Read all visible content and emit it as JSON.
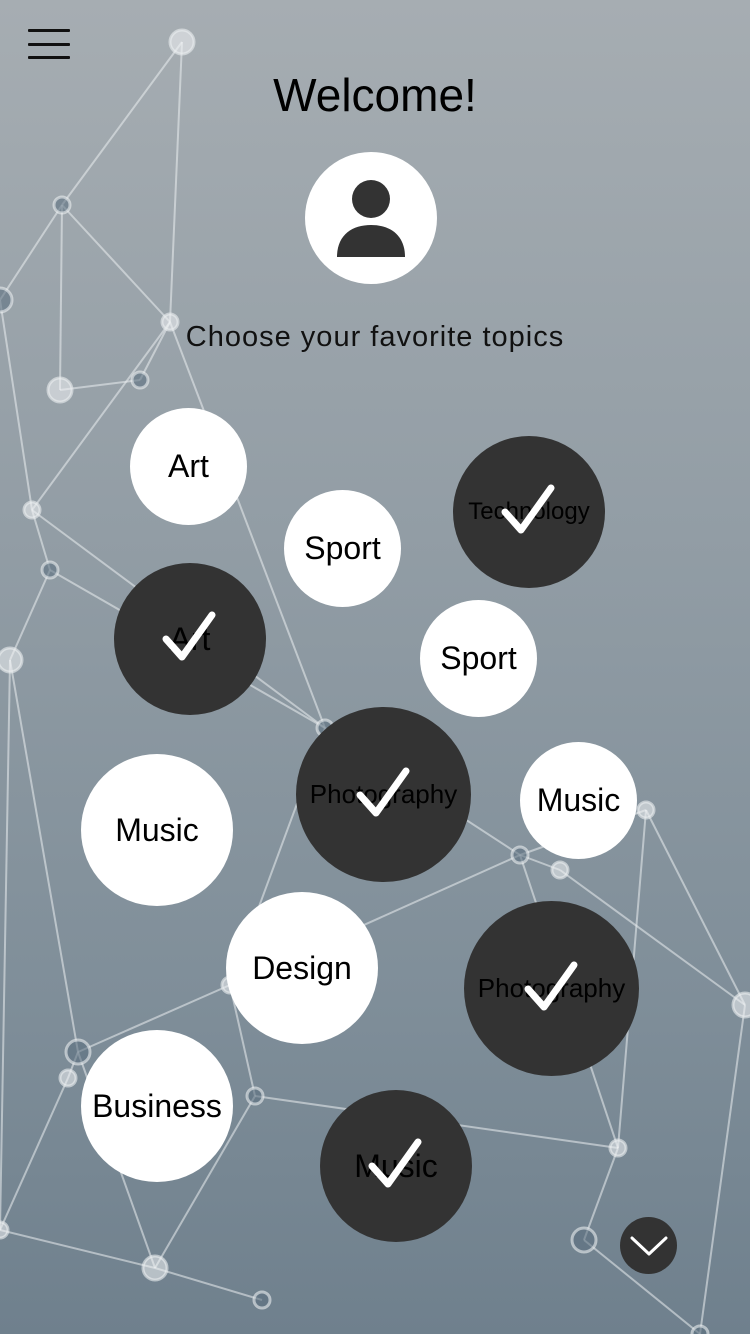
{
  "header": {
    "title": "Welcome!",
    "subtitle": "Choose your favorite topics"
  },
  "icons": {
    "menu": "hamburger-menu-icon",
    "avatar": "user-avatar-icon",
    "check": "checkmark-icon",
    "scroll": "chevron-down-icon"
  },
  "colors": {
    "selected_bubble": "#333333",
    "unselected_bubble": "#ffffff",
    "check": "#ffffff"
  },
  "topics": [
    {
      "label": "Art",
      "selected": false
    },
    {
      "label": "Sport",
      "selected": false
    },
    {
      "label": "Technology",
      "selected": true
    },
    {
      "label": "Art",
      "selected": true
    },
    {
      "label": "Sport",
      "selected": false
    },
    {
      "label": "Photography",
      "selected": true
    },
    {
      "label": "Music",
      "selected": false
    },
    {
      "label": "Music",
      "selected": false
    },
    {
      "label": "Design",
      "selected": false
    },
    {
      "label": "Photography",
      "selected": true
    },
    {
      "label": "Business",
      "selected": false
    },
    {
      "label": "Music",
      "selected": true
    }
  ]
}
